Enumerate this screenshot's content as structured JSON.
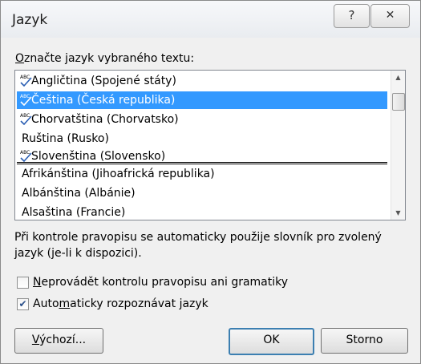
{
  "window": {
    "title": "Jazyk",
    "help_glyph": "?",
    "close_glyph": "✕"
  },
  "list_label": {
    "pre": "",
    "underlined": "O",
    "post": "značte jazyk vybraného textu:"
  },
  "languages": [
    {
      "label": "Angličtina (Spojené státy)",
      "spellcheck": true,
      "selected": false
    },
    {
      "label": "Čeština (Česká republika)",
      "spellcheck": true,
      "selected": true
    },
    {
      "label": "Chorvatština (Chorvatsko)",
      "spellcheck": true,
      "selected": false
    },
    {
      "label": "Ruština (Rusko)",
      "spellcheck": false,
      "selected": false
    },
    {
      "label": "Slovenština (Slovensko)",
      "spellcheck": true,
      "selected": false
    },
    {
      "label": "Afrikánština (Jihoafrická republika)",
      "spellcheck": false,
      "selected": false
    },
    {
      "label": "Albánština (Albánie)",
      "spellcheck": false,
      "selected": false
    },
    {
      "label": "Alsaština (Francie)",
      "spellcheck": false,
      "selected": false
    }
  ],
  "info_text": "Při kontrole pravopisu se automaticky použije slovník pro zvolený jazyk (je-li k dispozici).",
  "checkbox_no_proofing": {
    "checked": false,
    "pre": "",
    "underlined": "N",
    "post": "eprovádět kontrolu pravopisu ani gramatiky"
  },
  "checkbox_auto_detect": {
    "checked": true,
    "pre": "Auto",
    "underlined": "m",
    "post": "aticky rozpoznávat jazyk"
  },
  "buttons": {
    "default_btn": {
      "pre": "",
      "underlined": "V",
      "post": "ýchozí..."
    },
    "ok": "OK",
    "cancel": "Storno"
  },
  "colors": {
    "selection": "#3399ff",
    "check_mark": "#2a4f8a"
  }
}
